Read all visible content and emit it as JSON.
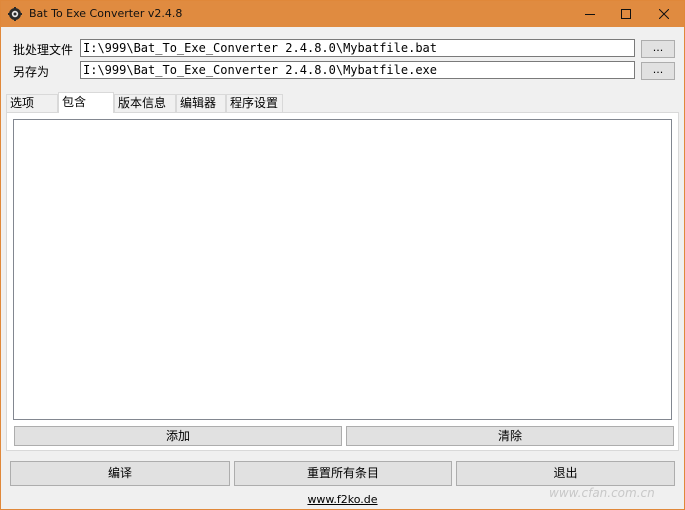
{
  "window": {
    "title": "Bat To Exe Converter v2.4.8",
    "title_bar_color": "#e08b40"
  },
  "fields": {
    "batch_label": "批处理文件",
    "batch_value": "I:\\999\\Bat_To_Exe_Converter 2.4.8.0\\Mybatfile.bat",
    "save_label": "另存为",
    "save_value": "I:\\999\\Bat_To_Exe_Converter 2.4.8.0\\Mybatfile.exe",
    "browse_label": "..."
  },
  "tabs": [
    {
      "label": "选项",
      "active": false
    },
    {
      "label": "包含",
      "active": true
    },
    {
      "label": "版本信息",
      "active": false
    },
    {
      "label": "编辑器",
      "active": false
    },
    {
      "label": "程序设置",
      "active": false
    }
  ],
  "include_panel": {
    "add_label": "添加",
    "clear_label": "清除"
  },
  "actions": {
    "compile_label": "编译",
    "reset_label": "重置所有条目",
    "exit_label": "退出"
  },
  "footer": {
    "link_text": "www.f2ko.de"
  },
  "watermark": {
    "text": "www.cfan.com.cn"
  },
  "icons": {
    "app": "gear-icon",
    "minimize": "minimize-icon",
    "maximize": "maximize-icon",
    "close": "close-icon"
  }
}
